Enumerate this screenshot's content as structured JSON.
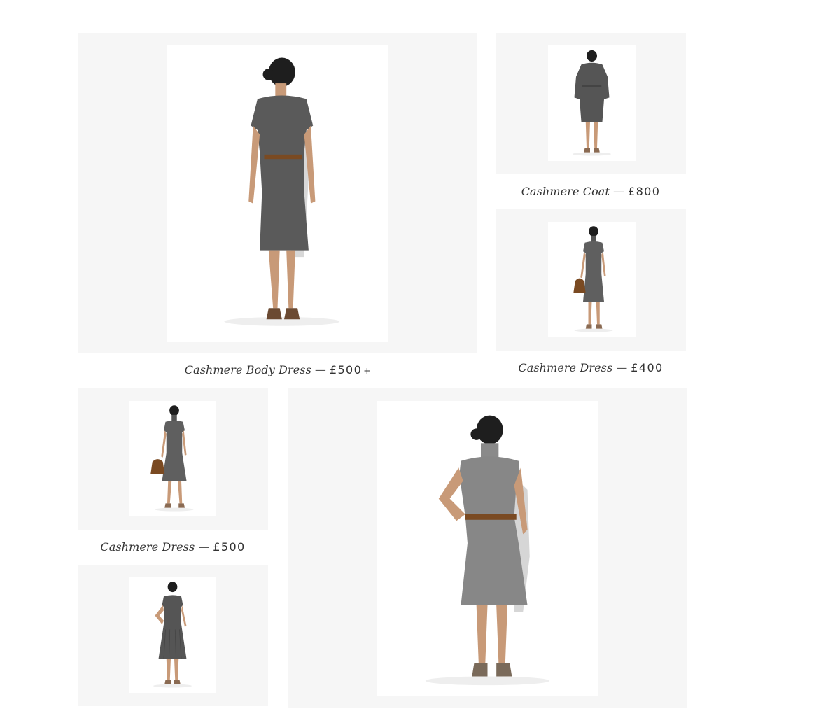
{
  "products": [
    {
      "id": "body-dress",
      "name": "Cashmere Body Dress",
      "separator": "—",
      "price": "£500",
      "more": "+",
      "photo_icon": "woman-dress-back-view"
    },
    {
      "id": "coat",
      "name": "Cashmere Coat",
      "separator": "—",
      "price": "£800",
      "photo_icon": "woman-coat-back-view"
    },
    {
      "id": "dress-400",
      "name": "Cashmere Dress",
      "separator": "—",
      "price": "£400",
      "photo_icon": "woman-dress-handbag-front-view"
    },
    {
      "id": "dress-500",
      "name": "Cashmere Dress",
      "separator": "—",
      "price": "£500",
      "photo_icon": "woman-dress-handbag-front-view"
    },
    {
      "id": "dress-back-small",
      "photo_icon": "woman-pleated-dress-back-view"
    },
    {
      "id": "dress-back-large",
      "photo_icon": "woman-sleeveless-dress-belt-back-view"
    }
  ],
  "colors": {
    "tile_background": "#f6f6f6",
    "photo_background": "#ffffff",
    "caption_text": "#333333",
    "dress_grey": "#5a5a5a",
    "hair": "#1e1e1e",
    "skin": "#c89a78",
    "belt": "#7a4a22"
  }
}
